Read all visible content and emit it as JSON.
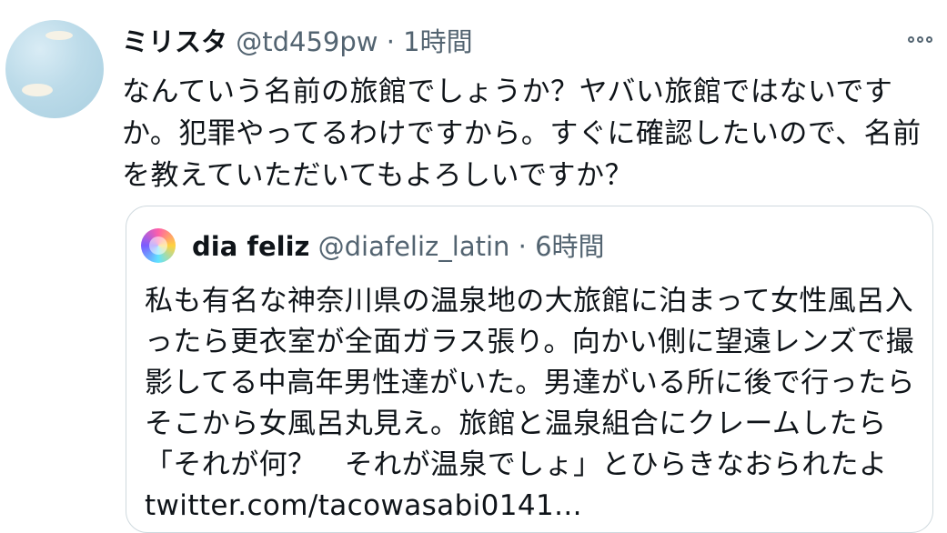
{
  "tweet": {
    "author_name": "ミリスタ",
    "handle": "@td459pw",
    "separator": "·",
    "time": "1時間",
    "text": "なんていう名前の旅館でしょうか？ヤバい旅館ではないですか。犯罪やってるわけですから。すぐに確認したいので、名前を教えていただいてもよろしいですか？",
    "more_icon": "more-horizontal-icon"
  },
  "quote": {
    "author_name": "dia feliz",
    "handle": "@diafeliz_latin",
    "separator": "·",
    "time": "6時間",
    "text": "私も有名な神奈川県の温泉地の大旅館に泊まって女性風呂入ったら更衣室が全面ガラス張り。向かい側に望遠レンズで撮影してる中高年男性達がいた。男達がいる所に後で行ったらそこから女風呂丸見え。旅館と温泉組合にクレームしたら「それが何？　それが温泉でしょ」とひらきなおられたよ twitter.com/tacowasabi0141..."
  },
  "colors": {
    "text": "#0f1419",
    "secondary": "#536471",
    "border": "#cfd9de"
  }
}
